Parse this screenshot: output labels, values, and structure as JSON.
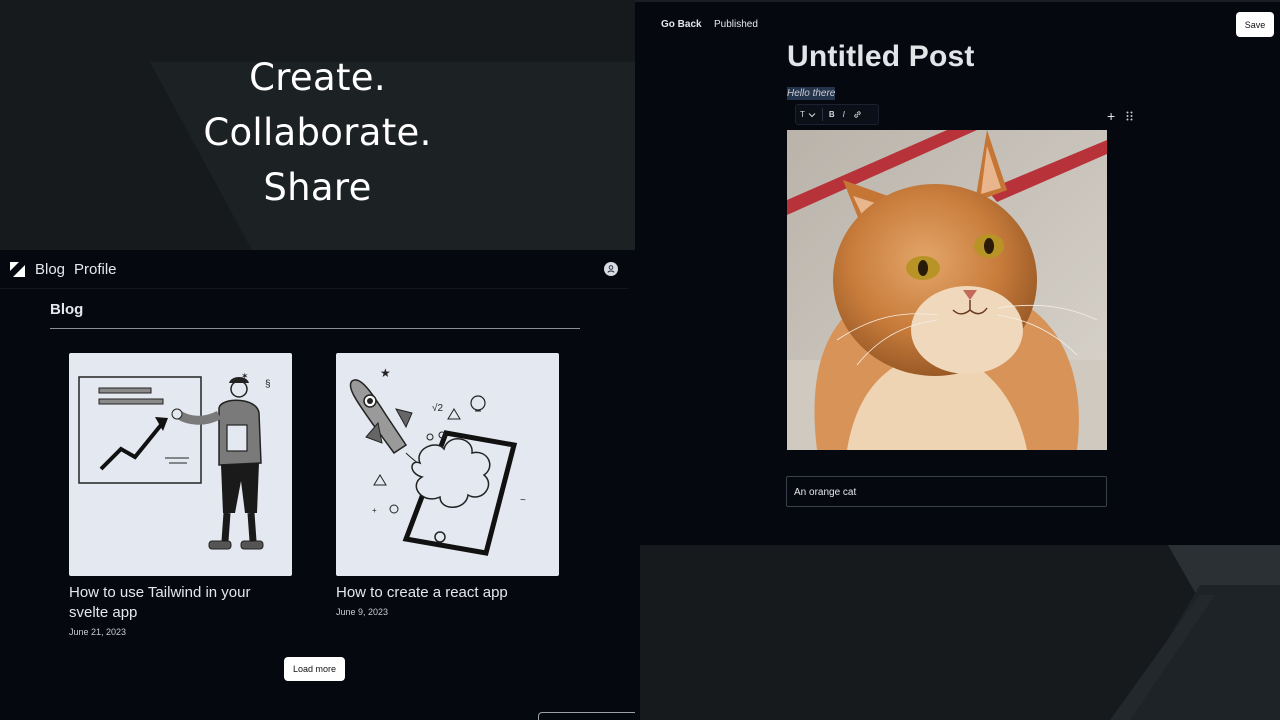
{
  "hero": {
    "line1": "Create.",
    "line2": "Collaborate.",
    "line3": "Share"
  },
  "blog_nav": {
    "blog_label": "Blog",
    "profile_label": "Profile"
  },
  "blog_section": {
    "title": "Blog",
    "posts": [
      {
        "title": "How to use Tailwind in your svelte app",
        "date": "June 21, 2023"
      },
      {
        "title": "How to create a react app",
        "date": "June 9, 2023"
      }
    ],
    "load_more_label": "Load more"
  },
  "editor": {
    "go_back_label": "Go Back",
    "published_label": "Published",
    "save_label": "Save",
    "post_title": "Untitled Post",
    "paragraph": "Hello there",
    "toolbar": {
      "text_type": "T",
      "bold": "B",
      "italic": "I"
    },
    "plus_label": "+",
    "image_caption": "An orange cat"
  },
  "colors": {
    "background": "#05080f",
    "hero_bg": "#161a1d",
    "button_bg": "#ffffff",
    "selection": "#24344c"
  }
}
